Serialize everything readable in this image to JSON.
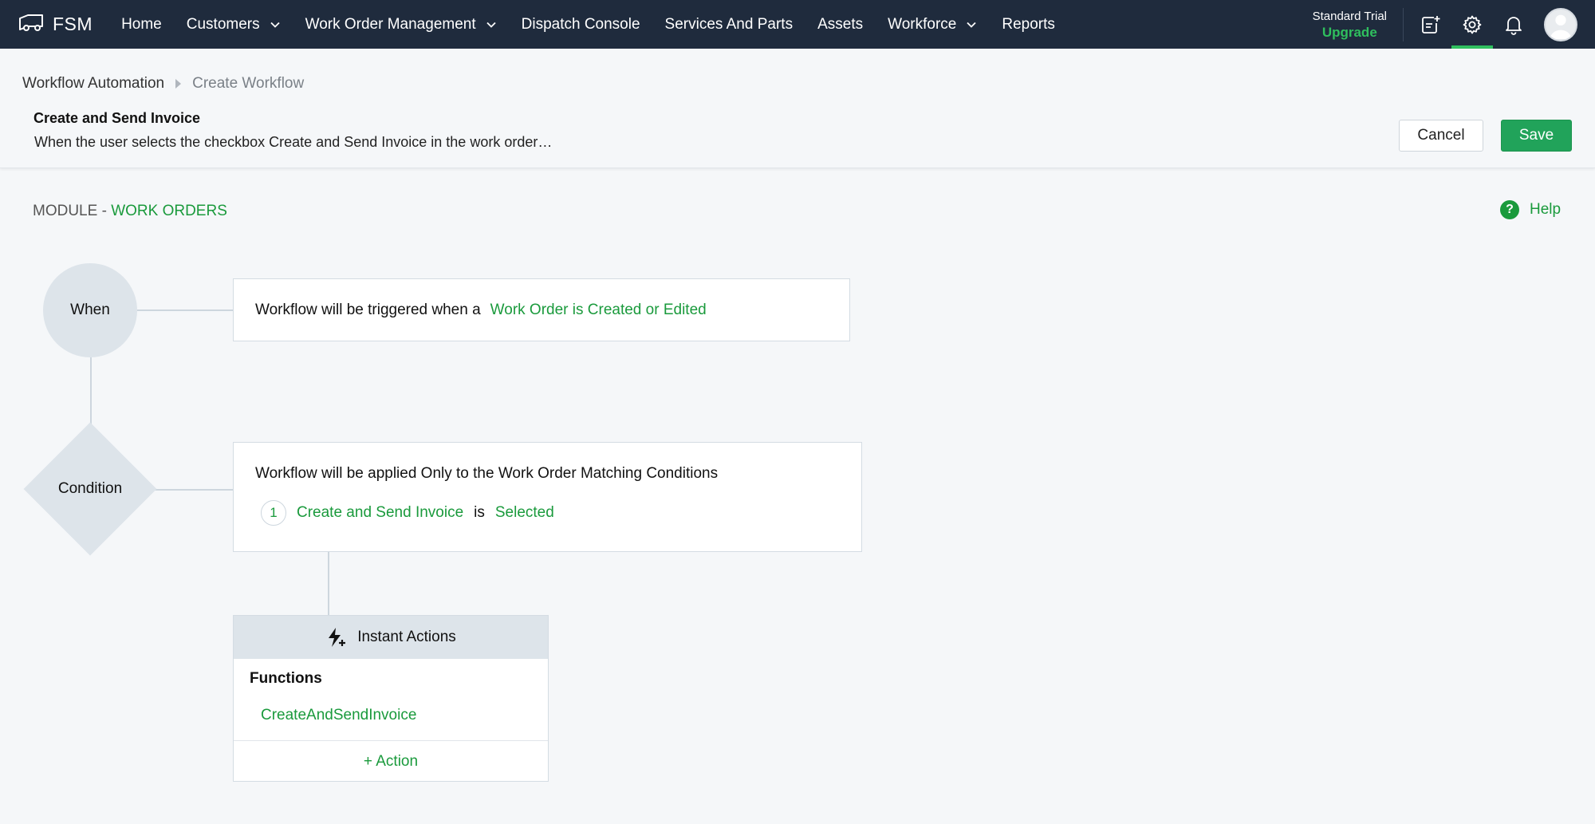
{
  "nav": {
    "brand": "FSM",
    "items": [
      {
        "label": "Home",
        "dropdown": false
      },
      {
        "label": "Customers",
        "dropdown": true
      },
      {
        "label": "Work Order Management",
        "dropdown": true
      },
      {
        "label": "Dispatch Console",
        "dropdown": false
      },
      {
        "label": "Services And Parts",
        "dropdown": false
      },
      {
        "label": "Assets",
        "dropdown": false
      },
      {
        "label": "Workforce",
        "dropdown": true
      },
      {
        "label": "Reports",
        "dropdown": false
      }
    ],
    "trial_label": "Standard Trial",
    "upgrade_label": "Upgrade",
    "icons": [
      "new-note-icon",
      "settings-gear-icon",
      "notification-bell-icon",
      "user-avatar"
    ],
    "active_icon": "settings-gear-icon"
  },
  "header": {
    "breadcrumb": {
      "parent": "Workflow Automation",
      "current": "Create Workflow"
    },
    "title": "Create and Send Invoice",
    "description": "When the user selects the checkbox Create and Send Invoice in the work order…",
    "cancel_label": "Cancel",
    "save_label": "Save"
  },
  "module": {
    "prefix": "MODULE - ",
    "name": "WORK ORDERS",
    "help_label": "Help"
  },
  "flow": {
    "when": {
      "node_label": "When",
      "text": "Workflow will be triggered when a",
      "trigger": "Work Order is Created or Edited"
    },
    "condition": {
      "node_label": "Condition",
      "text": "Workflow will be applied Only to the Work Order Matching Conditions",
      "rules": [
        {
          "number": "1",
          "field": "Create and Send Invoice",
          "operator": "is",
          "value": "Selected"
        }
      ]
    },
    "actions": {
      "header": "Instant Actions",
      "section_label": "Functions",
      "functions": [
        "CreateAndSendInvoice"
      ],
      "add_label": "+ Action"
    }
  },
  "colors": {
    "nav_bg": "#1f2b3d",
    "accent_green": "#1a9a3c",
    "save_green": "#21a35a",
    "node_gray": "#dde4ea"
  }
}
